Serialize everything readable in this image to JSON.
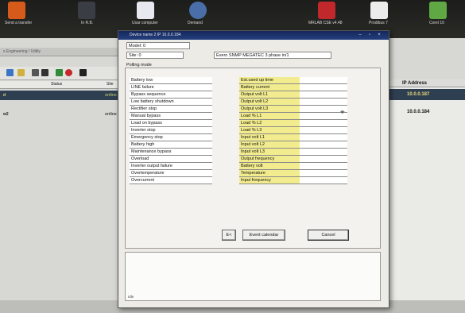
{
  "desktop": {
    "icons": [
      {
        "label": "Send a transfer",
        "color": "#d65a1a"
      },
      {
        "label": "In R.B.",
        "color": "#3a3e44"
      },
      {
        "label": "Usar computer",
        "color": "#e8e8f0"
      },
      {
        "label": "Demand",
        "color": "#4a6ea8"
      },
      {
        "label": "MRLAB CSE v4.48",
        "color": "#c0282c"
      },
      {
        "label": "Prodibus 7",
        "color": "#ececec"
      },
      {
        "label": "Corel 10",
        "color": "#5fa844"
      }
    ]
  },
  "bg_app": {
    "tab_text": "s Engineering / Utility",
    "grid_headers": [
      "Status",
      "Site"
    ],
    "rows": [
      {
        "name": "d",
        "status": "online"
      },
      {
        "name": "w2",
        "status": "online"
      }
    ],
    "right_header": "IP Address",
    "ip_rows": [
      "10.0.0.187",
      "10.0.0.184"
    ]
  },
  "dialog": {
    "title": "Device name 2  IP 10.0.0.184",
    "model_label": "Model: 0",
    "site_label": "Site: 0",
    "site_value": "Evero SNMP MEGATEC 3 phase in/1",
    "polling_label": "Polling mode",
    "left_items": [
      "Battery low",
      "LINE failure",
      "Bypass sequence",
      "Low battery shutdown",
      "Rectifier stop",
      "Manual bypass",
      "Load on bypass",
      "Inverter stop",
      "Emergency stop",
      "Battery high",
      "Maintenance bypass",
      "Overload",
      "Inverter output failure",
      "Overtemperature",
      "Overcurrent"
    ],
    "right_items": [
      "Est.used up time",
      "Battery current",
      "Output volt L1",
      "Output volt L2",
      "Output volt L3",
      "Load % L1",
      "Load % L2",
      "Load % L3",
      "Input volt L1",
      "Input volt L2",
      "Input volt L3",
      "Output frequency",
      "Battery volt",
      "Temperature",
      "Input frequency"
    ],
    "buttons": {
      "prev": "E<",
      "event_calendar": "Event calendar",
      "cancel": "Cancel"
    },
    "status_text": "Idle"
  },
  "colors": {
    "title_bar": "#1a3470",
    "highlight": "#f2ec8e",
    "selection": "#2f3f52"
  }
}
